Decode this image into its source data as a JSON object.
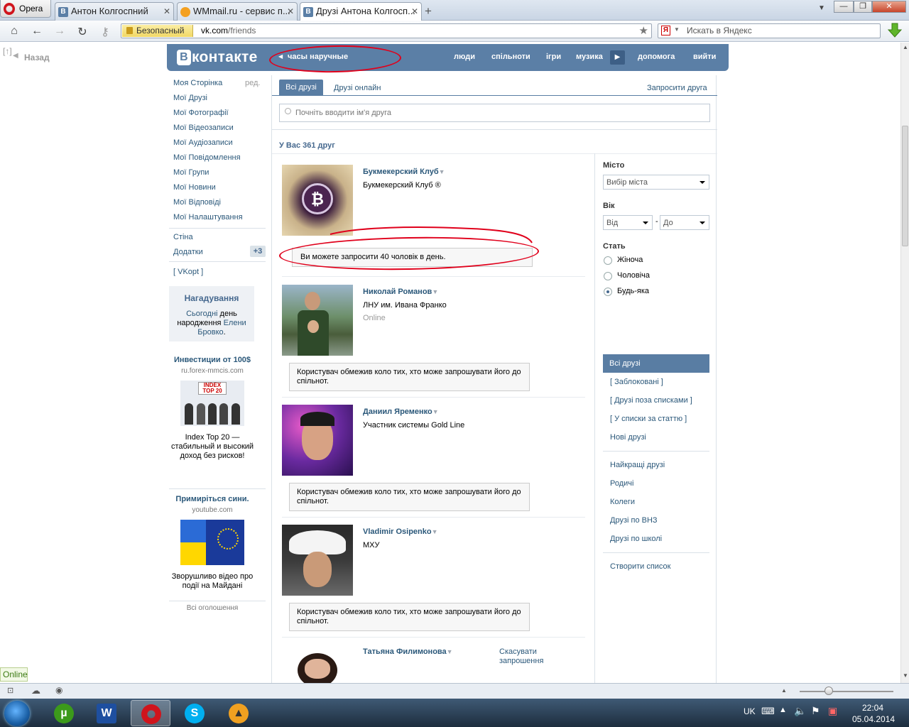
{
  "browser": {
    "opera_label": "Opera",
    "tabs": [
      {
        "title": "Антон Колгоспний",
        "icon": "В"
      },
      {
        "title": "WMmail.ru - сервис п...",
        "icon": "wm"
      },
      {
        "title": "Друзі Антона Колгосп...",
        "icon": "В"
      }
    ],
    "secure_label": "Безопасный",
    "url_host": "vk.com",
    "url_path": "/friends",
    "search_placeholder": "Искать в Яндекс",
    "yandex_glyph": "Я"
  },
  "page": {
    "up_label": "[↑]",
    "back_label": "Назад"
  },
  "vk": {
    "logo_b": "В",
    "logo_text": "контакте",
    "status": "часы наручные",
    "menu": [
      "люди",
      "спільноти",
      "ігри",
      "музика",
      "допомога",
      "вийти"
    ]
  },
  "leftnav": {
    "edit_label": "ред.",
    "items": [
      "Моя Сторінка",
      "Мої Друзі",
      "Мої Фотографії",
      "Мої Відеозаписи",
      "Мої Аудіозаписи",
      "Мої Повідомлення",
      "Мої Групи",
      "Мої Новини",
      "Мої Відповіді",
      "Мої Налаштування"
    ],
    "wall": "Стіна",
    "apps": "Додатки",
    "apps_badge": "+3",
    "vkopt": "[ VKopt ]",
    "reminder_title": "Нагадування",
    "reminder_text_1": "Сьогодні",
    "reminder_text_2": "день народження",
    "reminder_text_3": "Елени Бровко",
    "ads": [
      {
        "title": "Инвестиции от 100$",
        "domain": "ru.forex-mmcis.com",
        "text": "Index Top 20 — стабильный и высокий доход без рисков!"
      },
      {
        "title": "Примиріться сини.",
        "domain": "youtube.com",
        "text": "Зворушливо відео про події на Майдані"
      }
    ],
    "all_ads": "Всі оголошення"
  },
  "main": {
    "tab_all": "Всі друзі",
    "tab_online": "Друзі онлайн",
    "tab_invite": "Запросити друга",
    "search_placeholder": "Почніть вводити ім'я друга",
    "count_label": "У Вас 361 друг",
    "invite_limit": "Ви можете запросити 40 чоловік в день.",
    "restricted_notice": "Користувач обмежив коло тих, хто може запрошувати його до спільнот.",
    "cancel_request": "Скасувати запрошення",
    "friends": [
      {
        "name": "Букмекерский Клуб",
        "sub": "Букмекерский Клуб ®",
        "online": ""
      },
      {
        "name": "Николай Романов",
        "sub": "ЛНУ им. Ивана Франко",
        "online": "Online"
      },
      {
        "name": "Даниил Яременко",
        "sub": "Участник системы Gold Line",
        "online": ""
      },
      {
        "name": "Vladimir Osipenko",
        "sub": "МХУ",
        "online": ""
      },
      {
        "name": "Татьяна Филимонова",
        "sub": "",
        "online": ""
      }
    ]
  },
  "filter": {
    "city_label": "Місто",
    "city_select": "Вибір міста",
    "age_label": "Вік",
    "age_from": "Від",
    "age_dash": "-",
    "age_to": "До",
    "sex_label": "Стать",
    "sex_options": [
      "Жіноча",
      "Чоловіча",
      "Будь-яка"
    ],
    "sex_selected": "Будь-яка",
    "lists_active": "Всі друзі",
    "lists": [
      "[ Заблоковані ]",
      "[ Друзі поза списками ]",
      "[ У списки за статтю ]",
      "Нові друзі"
    ],
    "groups": [
      "Найкращі друзі",
      "Родичі",
      "Колеги",
      "Друзі по ВНЗ",
      "Друзі по школі"
    ],
    "create_list": "Створити список"
  },
  "statusbar": {
    "online_tag": "Online"
  },
  "taskbar": {
    "lang": "UK",
    "time": "22:04",
    "date": "05.04.2014"
  },
  "colors": {
    "vk_blue": "#5b7fa6",
    "link": "#2b587a",
    "annotation_red": "#e0001b"
  }
}
